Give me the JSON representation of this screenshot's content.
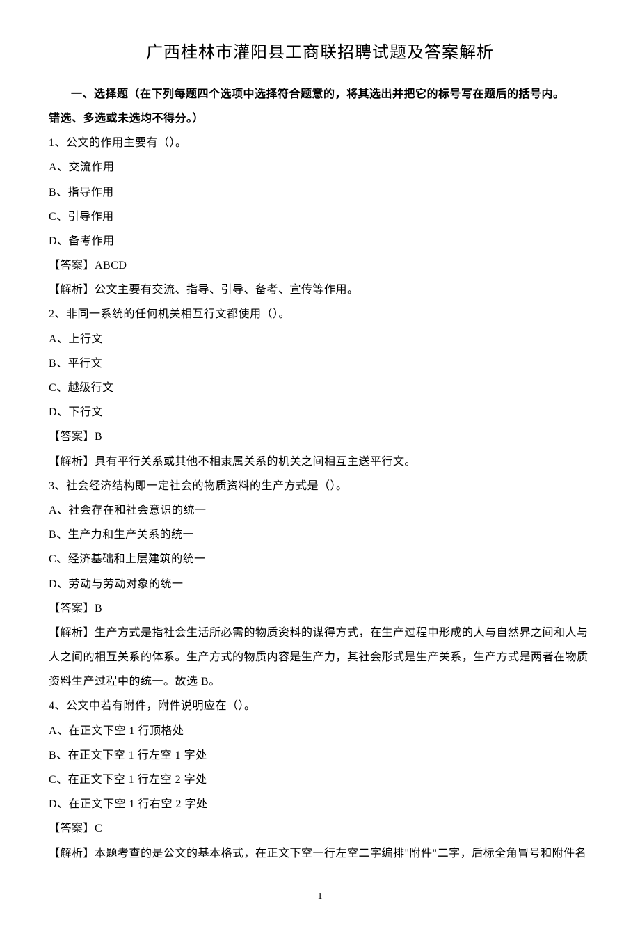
{
  "title": "广西桂林市灌阳县工商联招聘试题及答案解析",
  "section_header_line1": "一、选择题（在下列每题四个选项中选择符合题意的，将其选出并把它的标号写在题后的括号内。",
  "section_header_line2": "错选、多选或未选均不得分。）",
  "q1": {
    "stem": "1、公文的作用主要有（）。",
    "optA": "A、交流作用",
    "optB": "B、指导作用",
    "optC": "C、引导作用",
    "optD": "D、备考作用",
    "answer": "【答案】ABCD",
    "analysis": "【解析】公文主要有交流、指导、引导、备考、宣传等作用。"
  },
  "q2": {
    "stem": "2、非同一系统的任何机关相互行文都使用（）。",
    "optA": "A、上行文",
    "optB": "B、平行文",
    "optC": "C、越级行文",
    "optD": "D、下行文",
    "answer": "【答案】B",
    "analysis": "【解析】具有平行关系或其他不相隶属关系的机关之间相互主送平行文。"
  },
  "q3": {
    "stem": "3、社会经济结构即一定社会的物质资料的生产方式是（）。",
    "optA": "A、社会存在和社会意识的统一",
    "optB": "B、生产力和生产关系的统一",
    "optC": "C、经济基础和上层建筑的统一",
    "optD": "D、劳动与劳动对象的统一",
    "answer": "【答案】B",
    "analysis": "【解析】生产方式是指社会生活所必需的物质资料的谋得方式，在生产过程中形成的人与自然界之间和人与人之间的相互关系的体系。生产方式的物质内容是生产力，其社会形式是生产关系，生产方式是两者在物质资料生产过程中的统一。故选 B。"
  },
  "q4": {
    "stem": "4、公文中若有附件，附件说明应在（）。",
    "optA": "A、在正文下空 1 行顶格处",
    "optB": "B、在正文下空 1 行左空 1 字处",
    "optC": "C、在正文下空 1 行左空 2 字处",
    "optD": "D、在正文下空 1 行右空 2 字处",
    "answer": "【答案】C",
    "analysis": "【解析】本题考查的是公文的基本格式，在正文下空一行左空二字编排\"附件\"二字，后标全角冒号和附件名"
  },
  "page_number": "1"
}
